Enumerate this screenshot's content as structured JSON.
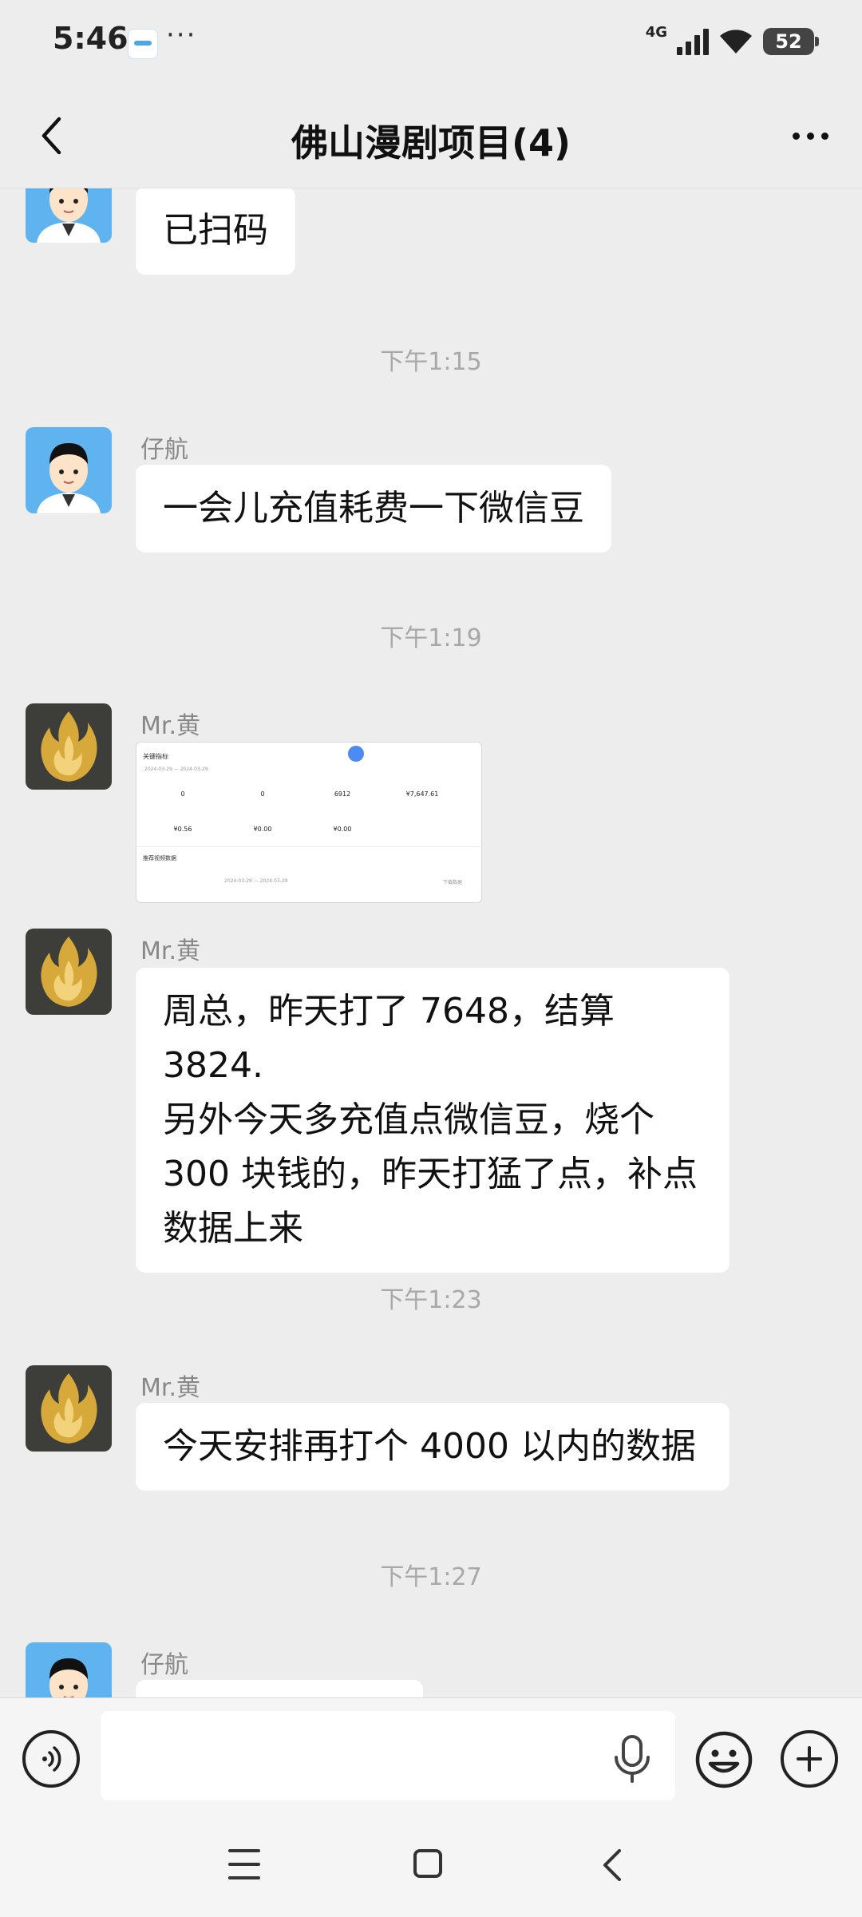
{
  "status_bar": {
    "time": "5:46",
    "more": "···",
    "network": "4G",
    "battery": "52",
    "icons": [
      "app-notification-icon",
      "signal-icon",
      "wifi-icon",
      "battery-icon"
    ]
  },
  "header": {
    "title": "佛山漫剧项目(4)",
    "icons": [
      "back-arrow-icon",
      "more-options-icon"
    ]
  },
  "messages": [
    {
      "type": "text",
      "sender": "",
      "avatar": "cartoon-man-avatar",
      "text": "已扫码"
    },
    {
      "type": "time",
      "text": "下午1:15"
    },
    {
      "type": "text",
      "sender": "仔航",
      "avatar": "cartoon-man-avatar",
      "text": "一会儿充值耗费一下微信豆"
    },
    {
      "type": "time",
      "text": "下午1:19"
    },
    {
      "type": "image",
      "sender": "Mr.黄",
      "avatar": "golden-flame-avatar",
      "image": {
        "header": "关键指标",
        "date_from": "2024-03-29",
        "date_to": "2024-03-29",
        "stats_row1": [
          "0",
          "0",
          "6912",
          "¥7,647.61"
        ],
        "stats_row2": [
          "¥0.56",
          "¥0.00",
          "¥0.00"
        ],
        "section": "推荐视频数据",
        "date_from2": "2024-03-29",
        "date_to2": "2024-03-29",
        "download": "下载数据"
      }
    },
    {
      "type": "text",
      "sender": "Mr.黄",
      "avatar": "golden-flame-avatar",
      "text_lines": [
        "周总，昨天打了 7648，结算 3824.",
        "另外今天多充值点微信豆，烧个",
        "300 块钱的，昨天打猛了点，补点",
        "数据上来"
      ]
    },
    {
      "type": "time",
      "text": "下午1:23"
    },
    {
      "type": "text",
      "sender": "Mr.黄",
      "avatar": "golden-flame-avatar",
      "text": "今天安排再打个 4000 以内的数据"
    },
    {
      "type": "time",
      "text": "下午1:27"
    },
    {
      "type": "text",
      "sender": "仔航",
      "avatar": "cartoon-man-avatar",
      "text": ""
    }
  ],
  "input_bar": {
    "placeholder": "",
    "icons": [
      "voice-mode-icon",
      "microphone-icon",
      "emoji-icon",
      "plus-icon"
    ]
  },
  "nav_bar": {
    "icons": [
      "menu-icon",
      "home-icon",
      "back-icon"
    ]
  }
}
